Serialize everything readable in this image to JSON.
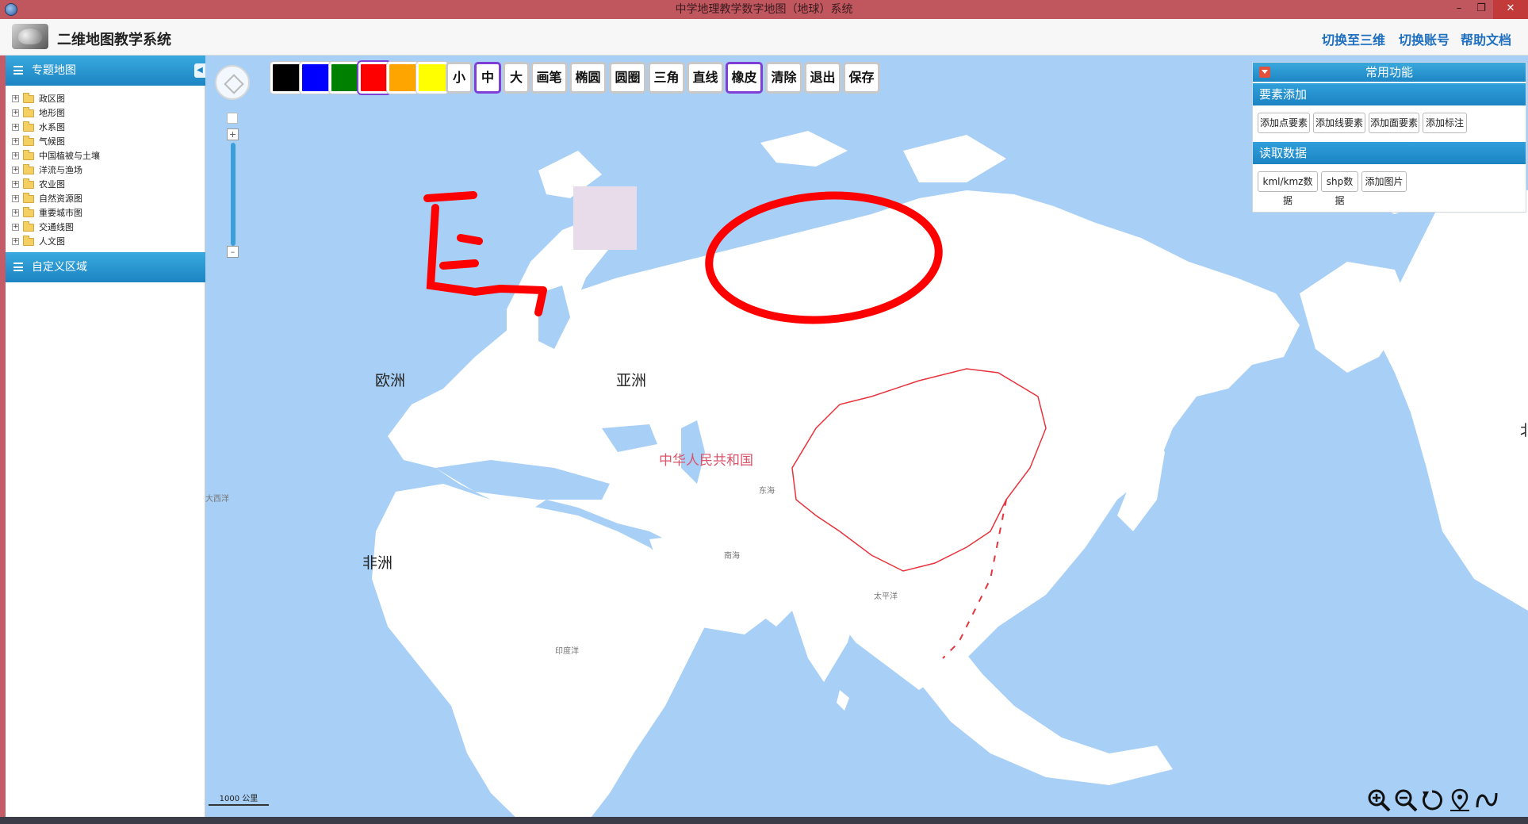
{
  "window": {
    "title": "中学地理教学数字地图（地球）系统",
    "controls": [
      "–",
      "❐",
      "✕"
    ]
  },
  "header": {
    "app_title": "二维地图教学系统",
    "links": [
      "切换至三维",
      "切换账号",
      "帮助文档"
    ]
  },
  "sidebar": {
    "thematic_title": "专题地图",
    "items": [
      "政区图",
      "地形图",
      "水系图",
      "气候图",
      "中国植被与土壤",
      "洋流与渔场",
      "农业图",
      "自然资源图",
      "重要城市图",
      "交通线图",
      "人文图"
    ],
    "custom_title": "自定义区域",
    "expand_glyph": "+",
    "collapse_glyph": "◀"
  },
  "toolbar": {
    "colors": [
      "#000000",
      "#0000ff",
      "#008000",
      "#ff0000",
      "#ffa500",
      "#ffff00"
    ],
    "selected_color": "#ff0000",
    "sizes": [
      "小",
      "中",
      "大"
    ],
    "selected_size": "中",
    "tools": [
      "画笔",
      "椭圆",
      "圆圈",
      "三角",
      "直线",
      "橡皮",
      "清除",
      "退出",
      "保存"
    ],
    "selected_tool": "橡皮"
  },
  "nav": {
    "zoom_in": "+",
    "zoom_out": "–"
  },
  "right_panel": {
    "title": "常用功能",
    "sections": [
      {
        "title": "要素添加",
        "buttons": [
          "添加点要素",
          "添加线要素",
          "添加面要素",
          "添加标注"
        ]
      },
      {
        "title": "读取数据",
        "buttons": [
          "kml/kmz数据",
          "shp数据",
          "添加图片"
        ]
      }
    ]
  },
  "map": {
    "labels": {
      "europe": "欧洲",
      "asia": "亚洲",
      "africa": "非洲",
      "china": "中华人民共和国",
      "atlantic": "大西洋",
      "pacific": "太平洋",
      "indian": "印度洋",
      "east_sea": "东海",
      "south_sea": "南海",
      "edge": "北"
    },
    "colors": {
      "ocean": "#a8cff6",
      "land": "#ffffff",
      "border": "#e8323c",
      "drawing": "#ff0000",
      "eraser_mark": "#e8dceb"
    },
    "scale": "1000 公里"
  },
  "map_tools": [
    "zoom-in-icon",
    "zoom-out-icon",
    "refresh-icon",
    "locate-icon",
    "measure-icon"
  ]
}
